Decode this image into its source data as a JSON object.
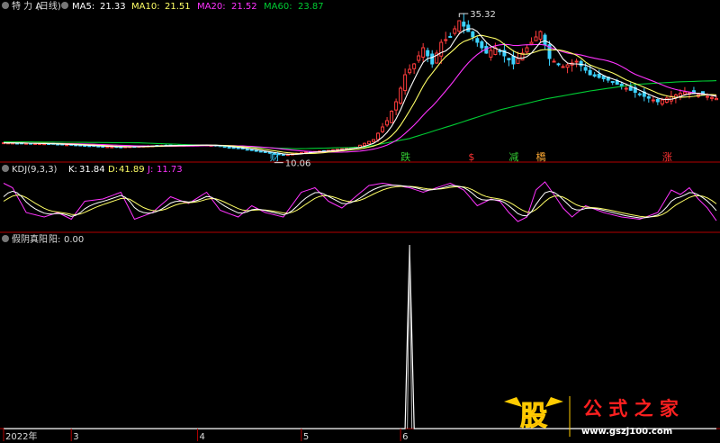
{
  "colors": {
    "bg": "#000000",
    "rise": "#ff3c3c",
    "fall": "#3cd2ff",
    "ma5": "#ffffff",
    "ma10": "#ffff66",
    "ma20": "#ff33ff",
    "ma60": "#00cc33",
    "divider": "#b40000",
    "kdj_k": "#ffffff",
    "kdj_d": "#ffff66",
    "kdj_j": "#ff33ff",
    "green_label": "#33cc33",
    "red_label": "#ff3333",
    "orange_label": "#ffaa33"
  },
  "main_panel": {
    "stock_label": "特 力 A",
    "period_label": "(日线)",
    "ma5": {
      "label": "MA5:",
      "value": "21.33"
    },
    "ma10": {
      "label": "MA10:",
      "value": "21.51"
    },
    "ma20": {
      "label": "MA20:",
      "value": "21.52"
    },
    "ma60": {
      "label": "MA60:",
      "value": "23.87"
    },
    "high_label": "35.32",
    "low_label": "10.06",
    "signals": [
      {
        "text": "财",
        "color": "#3cd2ff",
        "day": 60
      },
      {
        "text": "跌",
        "color": "#33cc33",
        "day": 89
      },
      {
        "text": "$",
        "color": "#ff3333",
        "day": 104
      },
      {
        "text": "减",
        "color": "#33cc33",
        "day": 113
      },
      {
        "text": "橋",
        "color": "#ffaa33",
        "day": 119
      },
      {
        "text": "涨",
        "color": "#ff3333",
        "day": 147
      }
    ]
  },
  "kdj_panel": {
    "name": "KDJ(9,3,3)",
    "k": {
      "label": "K:",
      "value": "31.84"
    },
    "d": {
      "label": "D:",
      "value": "41.89"
    },
    "j": {
      "label": "J:",
      "value": "11.73"
    }
  },
  "indicator_panel": {
    "name": "假阴真阳",
    "item": {
      "label": "阳:",
      "value": "0.00"
    }
  },
  "x_axis": {
    "labels": [
      {
        "text": "2022年",
        "day": 0
      },
      {
        "text": "3",
        "day": 15
      },
      {
        "text": "4",
        "day": 43
      },
      {
        "text": "5",
        "day": 66
      },
      {
        "text": "6",
        "day": 88
      }
    ]
  },
  "watermark": {
    "logo": "股",
    "text": "公 式 之 家",
    "url": "www.gszj100.com"
  },
  "chart_data": [
    {
      "type": "line",
      "title": "特 力 A (日线)",
      "x_unit": "trading day index (2022)",
      "ylim": [
        9.5,
        36.5
      ],
      "high": 35.32,
      "low": 10.06,
      "price_keypoints": [
        [
          0,
          12.4
        ],
        [
          10,
          12.2
        ],
        [
          15,
          12.0
        ],
        [
          25,
          11.6
        ],
        [
          35,
          11.9
        ],
        [
          45,
          12.0
        ],
        [
          52,
          11.4
        ],
        [
          58,
          10.6
        ],
        [
          62,
          10.1
        ],
        [
          66,
          10.6
        ],
        [
          72,
          11.0
        ],
        [
          78,
          11.6
        ],
        [
          82,
          13.0
        ],
        [
          85,
          16.5
        ],
        [
          87,
          20.0
        ],
        [
          89,
          25.0
        ],
        [
          91,
          27.0
        ],
        [
          93,
          30.0
        ],
        [
          95,
          27.0
        ],
        [
          97,
          31.0
        ],
        [
          99,
          32.0
        ],
        [
          101,
          35.0
        ],
        [
          103,
          33.0
        ],
        [
          105,
          31.0
        ],
        [
          107,
          29.0
        ],
        [
          109,
          30.0
        ],
        [
          111,
          28.5
        ],
        [
          113,
          27.0
        ],
        [
          115,
          29.0
        ],
        [
          117,
          31.0
        ],
        [
          119,
          33.0
        ],
        [
          121,
          28.0
        ],
        [
          124,
          26.5
        ],
        [
          127,
          27.5
        ],
        [
          130,
          25.0
        ],
        [
          134,
          24.0
        ],
        [
          138,
          22.5
        ],
        [
          142,
          21.0
        ],
        [
          145,
          20.0
        ],
        [
          148,
          21.0
        ],
        [
          151,
          21.8
        ],
        [
          155,
          21.2
        ],
        [
          158,
          20.6
        ]
      ],
      "ma60_keypoints": [
        [
          0,
          12.6
        ],
        [
          30,
          12.4
        ],
        [
          55,
          11.6
        ],
        [
          65,
          11.3
        ],
        [
          80,
          11.6
        ],
        [
          90,
          13.2
        ],
        [
          100,
          15.8
        ],
        [
          110,
          18.5
        ],
        [
          120,
          20.5
        ],
        [
          130,
          22.0
        ],
        [
          140,
          23.2
        ],
        [
          150,
          23.7
        ],
        [
          158,
          23.9
        ]
      ],
      "series": [
        {
          "name": "MA5",
          "last": 21.33
        },
        {
          "name": "MA10",
          "last": 21.51
        },
        {
          "name": "MA20",
          "last": 21.52
        },
        {
          "name": "MA60",
          "last": 23.87
        }
      ]
    },
    {
      "type": "line",
      "title": "KDJ(9,3,3)",
      "ylim": [
        -10,
        110
      ],
      "j_keypoints": [
        [
          0,
          95
        ],
        [
          2,
          85
        ],
        [
          5,
          30
        ],
        [
          9,
          20
        ],
        [
          12,
          30
        ],
        [
          15,
          15
        ],
        [
          18,
          55
        ],
        [
          22,
          60
        ],
        [
          26,
          75
        ],
        [
          29,
          15
        ],
        [
          33,
          30
        ],
        [
          37,
          65
        ],
        [
          41,
          50
        ],
        [
          45,
          75
        ],
        [
          48,
          35
        ],
        [
          52,
          20
        ],
        [
          55,
          45
        ],
        [
          58,
          30
        ],
        [
          62,
          20
        ],
        [
          66,
          75
        ],
        [
          69,
          85
        ],
        [
          72,
          55
        ],
        [
          75,
          40
        ],
        [
          78,
          65
        ],
        [
          81,
          90
        ],
        [
          84,
          95
        ],
        [
          87,
          90
        ],
        [
          90,
          85
        ],
        [
          93,
          75
        ],
        [
          96,
          85
        ],
        [
          99,
          95
        ],
        [
          102,
          80
        ],
        [
          105,
          45
        ],
        [
          108,
          60
        ],
        [
          110,
          55
        ],
        [
          112,
          30
        ],
        [
          114,
          10
        ],
        [
          116,
          20
        ],
        [
          118,
          80
        ],
        [
          120,
          98
        ],
        [
          122,
          70
        ],
        [
          124,
          40
        ],
        [
          126,
          20
        ],
        [
          129,
          45
        ],
        [
          133,
          30
        ],
        [
          137,
          20
        ],
        [
          141,
          15
        ],
        [
          145,
          30
        ],
        [
          148,
          80
        ],
        [
          150,
          70
        ],
        [
          152,
          85
        ],
        [
          154,
          60
        ],
        [
          156,
          40
        ],
        [
          158,
          11.73
        ]
      ],
      "series": [
        {
          "name": "K",
          "last": 31.84
        },
        {
          "name": "D",
          "last": 41.89
        },
        {
          "name": "J",
          "last": 11.73
        }
      ]
    },
    {
      "type": "line",
      "title": "假阴真阳",
      "ylim": [
        0,
        1
      ],
      "values": [
        [
          0,
          0
        ],
        [
          89,
          0
        ],
        [
          90,
          1
        ],
        [
          91,
          0
        ],
        [
          158,
          0
        ]
      ],
      "series": [
        {
          "name": "阳",
          "last": 0.0
        }
      ]
    }
  ]
}
